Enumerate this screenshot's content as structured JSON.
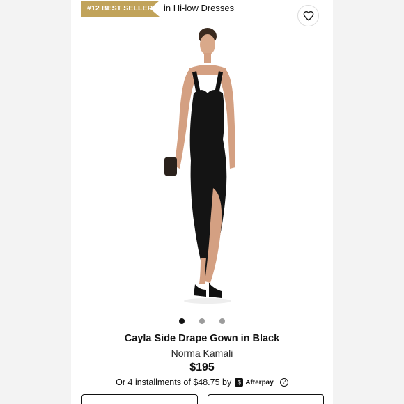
{
  "badge": {
    "label": "#12 BEST SELLER"
  },
  "category": {
    "label": "in Hi-low Dresses"
  },
  "carousel": {
    "count": 3,
    "active_index": 0
  },
  "product": {
    "title": "Cayla Side Drape Gown in Black",
    "brand": "Norma Kamali",
    "price": "$195"
  },
  "installments": {
    "text": "Or 4 installments of $48.75 by",
    "provider": "Afterpay",
    "provider_logo": "$",
    "help": "?"
  },
  "icons": {
    "favorite": "heart-outline-icon",
    "help": "question-circle-icon"
  },
  "colors": {
    "badge": "#c1a35a",
    "text": "#111111",
    "background": "#f4f4f4"
  }
}
